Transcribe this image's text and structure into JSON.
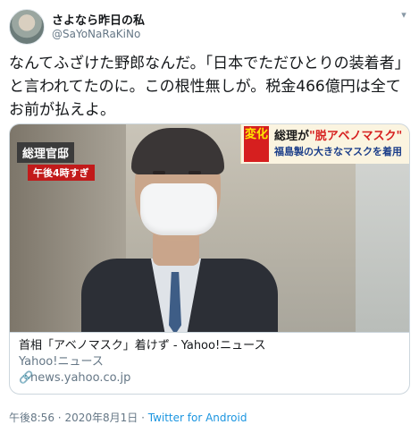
{
  "tweet": {
    "display_name": "さよなら昨日の私",
    "handle": "@SaYoNaRaKiNo",
    "text": "なんてふざけた野郎なんだ。「日本でただひとりの装着者」と言われてたのに。この根性無しが。税金466億円は全てお前が払えよ。"
  },
  "card": {
    "image_caption_left_1": "総理官邸",
    "image_caption_left_2": "午後4時すぎ",
    "image_badge": "変化",
    "image_caption_right_1_prefix": "総理が",
    "image_caption_right_1_highlight": "\"脱アベノマスク\"",
    "image_caption_right_2": "福島製の大きなマスクを着用",
    "title": "首相「アベノマスク」着けず - Yahoo!ニュース",
    "description": "Yahoo!ニュース",
    "link": "news.yahoo.co.jp"
  },
  "meta": {
    "time": "午後8:56",
    "separator": "·",
    "date": "2020年8月1日",
    "source": "Twitter for Android"
  },
  "colors": {
    "link": "#1b95e0",
    "secondary_text": "#657786",
    "border": "#ccd6dd"
  },
  "icons": {
    "menu": "chevron-down-icon",
    "link": "link-icon"
  }
}
